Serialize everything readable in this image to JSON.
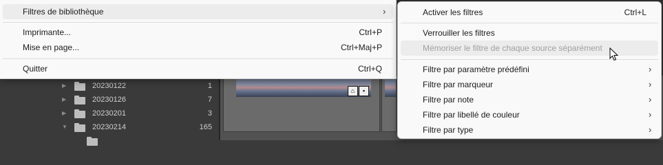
{
  "main_menu": {
    "items": [
      {
        "label": "Filtres de bibliothèque",
        "accel": "",
        "submenu": true
      },
      {
        "label": "Imprimante...",
        "accel": "Ctrl+P"
      },
      {
        "label": "Mise en page...",
        "accel": "Ctrl+Maj+P"
      },
      {
        "label": "Quitter",
        "accel": "Ctrl+Q"
      }
    ]
  },
  "sub_menu": {
    "items": [
      {
        "label": "Activer les filtres",
        "accel": "Ctrl+L"
      },
      {
        "label": "Verrouiller les filtres"
      },
      {
        "label": "Mémoriser le filtre de chaque source séparément",
        "disabled": true
      },
      {
        "label": "Filtre par paramètre prédéfini",
        "submenu": true
      },
      {
        "label": "Filtre par marqueur",
        "submenu": true
      },
      {
        "label": "Filtre par note",
        "submenu": true
      },
      {
        "label": "Filtre par libellé de couleur",
        "submenu": true
      },
      {
        "label": "Filtre par type",
        "submenu": true
      }
    ]
  },
  "folders": [
    {
      "name": "20230122",
      "count": "1",
      "expanded": false
    },
    {
      "name": "20230126",
      "count": "7",
      "expanded": false
    },
    {
      "name": "20230201",
      "count": "3",
      "expanded": false
    },
    {
      "name": "20230214",
      "count": "165",
      "expanded": true
    }
  ],
  "icons": {
    "submenu_arrow": "chevron-right-icon",
    "folder": "folder-icon",
    "cursor": "mouse-pointer-icon"
  },
  "colors": {
    "menu_bg": "#f9f9f9",
    "hover_bg": "#ececec",
    "disabled_text": "#a0a0a0",
    "app_bg": "#3a3a3a"
  }
}
